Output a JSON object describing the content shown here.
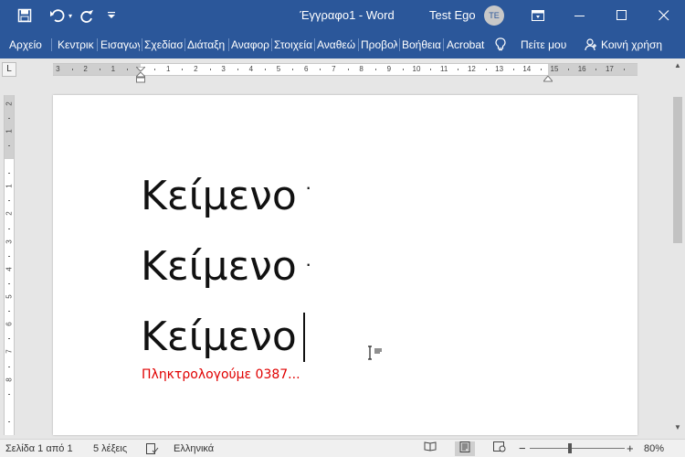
{
  "window": {
    "title": "Έγγραφο1 - Word",
    "user_name": "Test Ego",
    "user_initials": "TE"
  },
  "qat": {
    "save_icon": "save-icon",
    "undo_icon": "undo-icon",
    "redo_icon": "redo-icon",
    "customize_icon": "customize-qat-icon"
  },
  "ribbon_tabs": [
    {
      "label": "Αρχείο"
    },
    {
      "label": "Κεντρική"
    },
    {
      "label": "Εισαγωγή"
    },
    {
      "label": "Σχεδίαση"
    },
    {
      "label": "Διάταξη"
    },
    {
      "label": "Αναφορές"
    },
    {
      "label": "Στοιχεία"
    },
    {
      "label": "Αναθεώρηση"
    },
    {
      "label": "Προβολή"
    },
    {
      "label": "Βοήθεια"
    },
    {
      "label": "Acrobat"
    }
  ],
  "tell_me": "Πείτε μου",
  "share": "Κοινή χρήση",
  "ruler": {
    "tab_selector": "L",
    "numbers": [
      "3",
      "2",
      "1",
      "1",
      "2",
      "3",
      "4",
      "5",
      "6",
      "7",
      "8",
      "9",
      "10",
      "11",
      "12",
      "13",
      "14",
      "15",
      "16",
      "17"
    ],
    "vertical_numbers": [
      "2",
      "1",
      "1",
      "2",
      "3",
      "4",
      "5",
      "6",
      "7",
      "8"
    ]
  },
  "document": {
    "lines": [
      "Κείμενο",
      "Κείμενο",
      "Κείμενο"
    ],
    "status_text": "Πληκτρολογούμε 0387..."
  },
  "statusbar": {
    "page": "Σελίδα 1 από 1",
    "words": "5 λέξεις",
    "language": "Ελληνικά",
    "zoom": "80%",
    "zoom_minus": "−",
    "zoom_plus": "+",
    "zoom_level_fraction": 0.42
  },
  "colors": {
    "titlebar": "#2b579a",
    "status_text": "#e00000"
  }
}
